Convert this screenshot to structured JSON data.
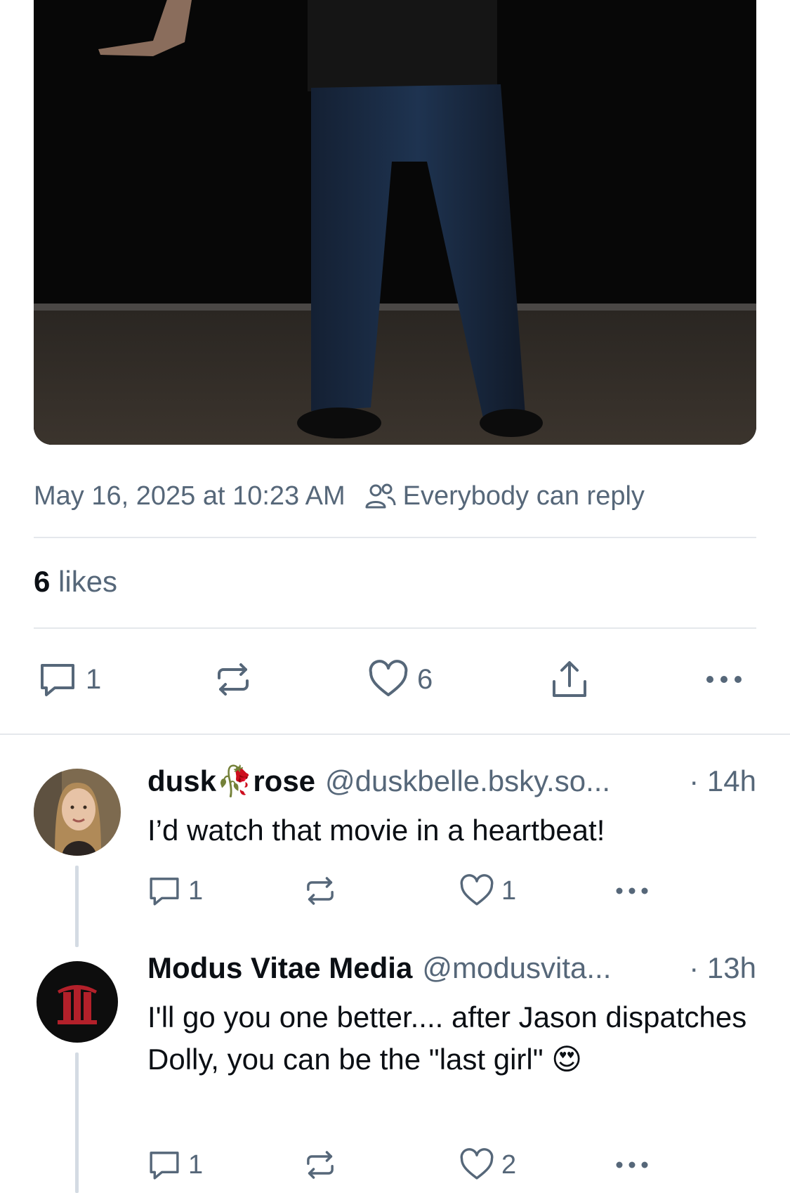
{
  "post": {
    "timestamp": "May 16, 2025 at 10:23 AM",
    "reply_setting": "Everybody can reply",
    "likes_count": "6",
    "likes_label": "likes",
    "actions": {
      "reply_count": "1",
      "like_count": "6"
    }
  },
  "replies": [
    {
      "name_part1": "dusk",
      "name_emoji": "🥀",
      "name_part2": "rose",
      "handle": "@duskbelle.bsky.so...",
      "time": "· 14h",
      "text": "I’d watch that movie in a heartbeat!",
      "reply_count": "1",
      "like_count": "1"
    },
    {
      "name": "Modus Vitae Media",
      "handle": "@modusvita...",
      "time": "· 13h",
      "text": "I'll go you one better.... after Jason dispatches Dolly, you can be the \"last girl\" 😍",
      "reply_count": "1",
      "like_count": "2"
    }
  ],
  "colors": {
    "muted": "#566779",
    "text": "#0b0f14",
    "divider": "#e5e8ec",
    "thread_line": "#d4dbe3"
  }
}
